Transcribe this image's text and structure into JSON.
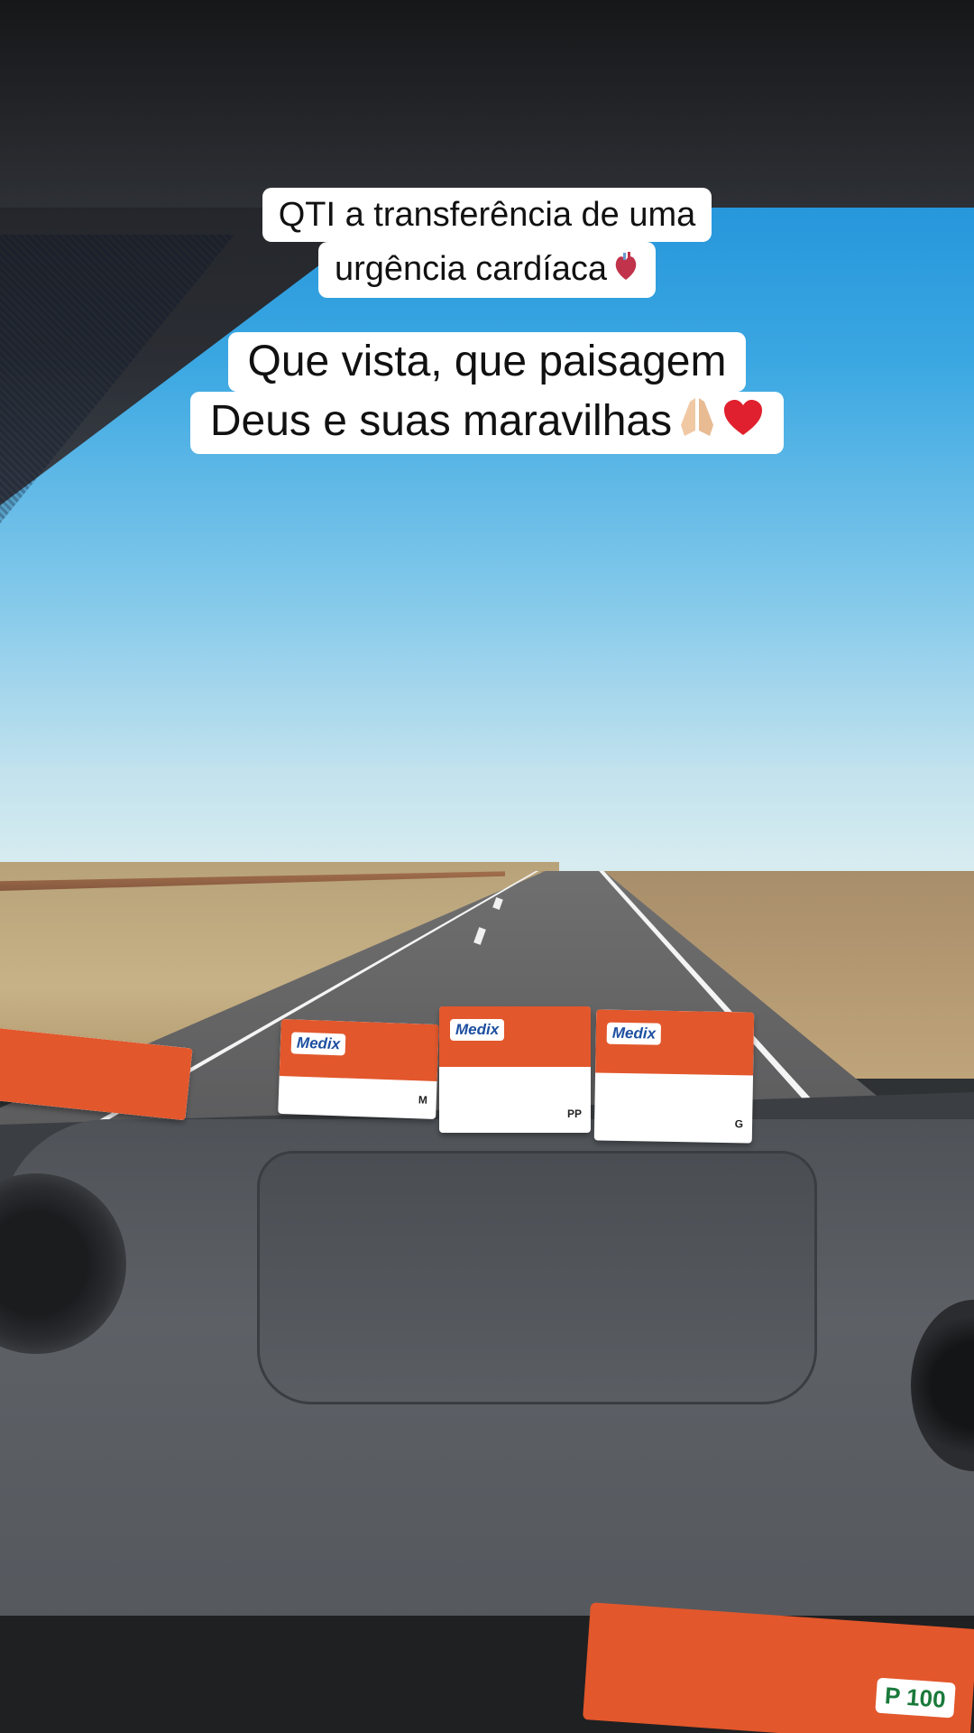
{
  "captions": {
    "top": {
      "line1": "QTI a transferência de uma",
      "line2": "urgência cardíaca",
      "emoji": "anatomical-heart-icon"
    },
    "main": {
      "line1": "Que vista, que paisagem",
      "line2": "Deus e suas maravilhas",
      "emojis": [
        "praying-hands-icon",
        "red-heart-icon"
      ]
    }
  },
  "dashboard_items": {
    "box_brand": "Medix",
    "box_sizes": [
      "M",
      "PP",
      "G"
    ],
    "box_count": "100",
    "bottom_box_size": "P 100"
  },
  "colors": {
    "caption_bg": "#ffffff",
    "caption_text": "#111111",
    "box_orange": "#e2572c",
    "sky": "#3aa7e2"
  }
}
